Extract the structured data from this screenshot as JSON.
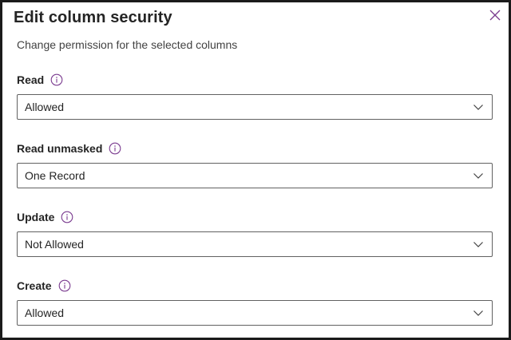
{
  "dialog": {
    "title": "Edit column security",
    "subtitle": "Change permission for the selected columns",
    "accent_color": "#7a3b8f",
    "close_icon": "close-icon"
  },
  "fields": [
    {
      "label": "Read",
      "value": "Allowed",
      "info_icon": "info-icon",
      "dropdown_icon": "chevron-down-icon"
    },
    {
      "label": "Read unmasked",
      "value": "One Record",
      "info_icon": "info-icon",
      "dropdown_icon": "chevron-down-icon"
    },
    {
      "label": "Update",
      "value": "Not Allowed",
      "info_icon": "info-icon",
      "dropdown_icon": "chevron-down-icon"
    },
    {
      "label": "Create",
      "value": "Allowed",
      "info_icon": "info-icon",
      "dropdown_icon": "chevron-down-icon"
    }
  ]
}
